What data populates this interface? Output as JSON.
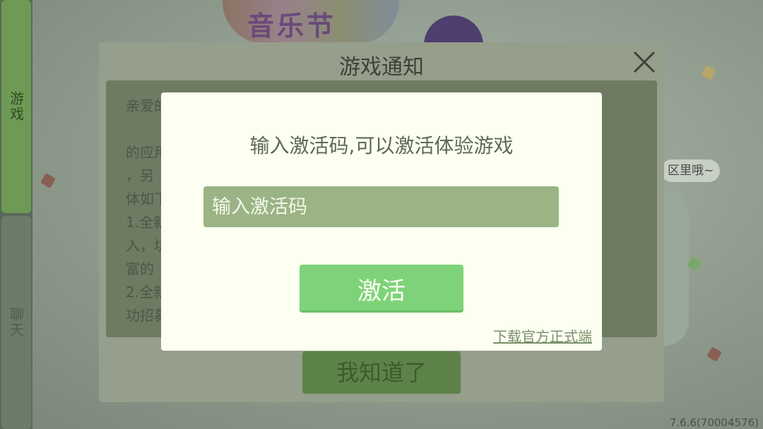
{
  "sidebar": {
    "tabs": [
      {
        "label": "游戏",
        "active": true
      },
      {
        "label": "聊天",
        "active": false
      }
    ]
  },
  "background": {
    "logo_text": "音乐节",
    "bubble_text": "区里哦~",
    "version": "7.6.6(70004576)"
  },
  "notice_dialog": {
    "title": "游戏通知",
    "close_icon": "close-icon",
    "body_text": "亲爱的\n        玩                                                            各自\n的应用                                                        战争\n，另                                                            。具\n体如下\n1.全新                                                        起进\n入，坑                                                        更加丰\n富的                                                              \n2.全新                                                        。成\n功招募                                                        精灵。\n",
    "confirm_label": "我知道了"
  },
  "activation_modal": {
    "message": "输入激活码,可以激活体验游戏",
    "input": {
      "value": "",
      "placeholder": "输入激活码"
    },
    "activate_label": "激活",
    "download_link": "下载官方正式端"
  },
  "colors": {
    "accent_green": "#7ed37a",
    "input_bg": "#9ab485",
    "modal_bg": "#fdfff1"
  }
}
